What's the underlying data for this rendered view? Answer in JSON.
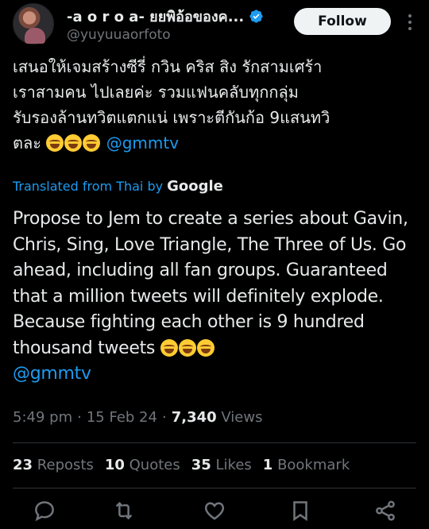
{
  "author": {
    "display_name": "-a o r o a- ยยพิอ้อของค...",
    "handle": "@yuyuuaorfoto",
    "verified": true
  },
  "follow_label": "Follow",
  "original_text": {
    "line1": "เสนอให้เจมสร้างซีรี่ กวิน คริส สิง รักสามเศร้า",
    "line2": "เราสามคน ไปเลยค่ะ รวมแฟนคลับทุกกลุ่ม",
    "line3": "รับรองล้านทวิตแตกแน่ เพราะตีกันก้อ 9แสนทวิ",
    "line4": "ตละ",
    "mention": "@gmmtv"
  },
  "translation": {
    "label": "Translated from Thai by",
    "provider": "Google",
    "text": "Propose to Jem to create a series about Gavin, Chris, Sing, Love Triangle, The Three of Us. Go ahead, including all fan groups. Guaranteed that a million tweets will definitely explode. Because fighting each other is 9 hundred thousand tweets",
    "mention": "@gmmtv"
  },
  "meta": {
    "time": "5:49 pm",
    "date": "15 Feb 24",
    "views_count": "7,340",
    "views_label": "Views"
  },
  "stats": {
    "reposts_count": "23",
    "reposts_label": "Reposts",
    "quotes_count": "10",
    "quotes_label": "Quotes",
    "likes_count": "35",
    "likes_label": "Likes",
    "bookmarks_count": "1",
    "bookmarks_label": "Bookmark"
  },
  "colors": {
    "background": "#000000",
    "text": "#e7e9ea",
    "muted": "#71767b",
    "accent": "#1d9bf0",
    "divider": "#2f3336"
  },
  "icons": [
    "verified-badge-icon",
    "more-icon",
    "reply-icon",
    "repost-icon",
    "like-icon",
    "bookmark-icon",
    "share-icon",
    "laughing-emoji-icon"
  ]
}
